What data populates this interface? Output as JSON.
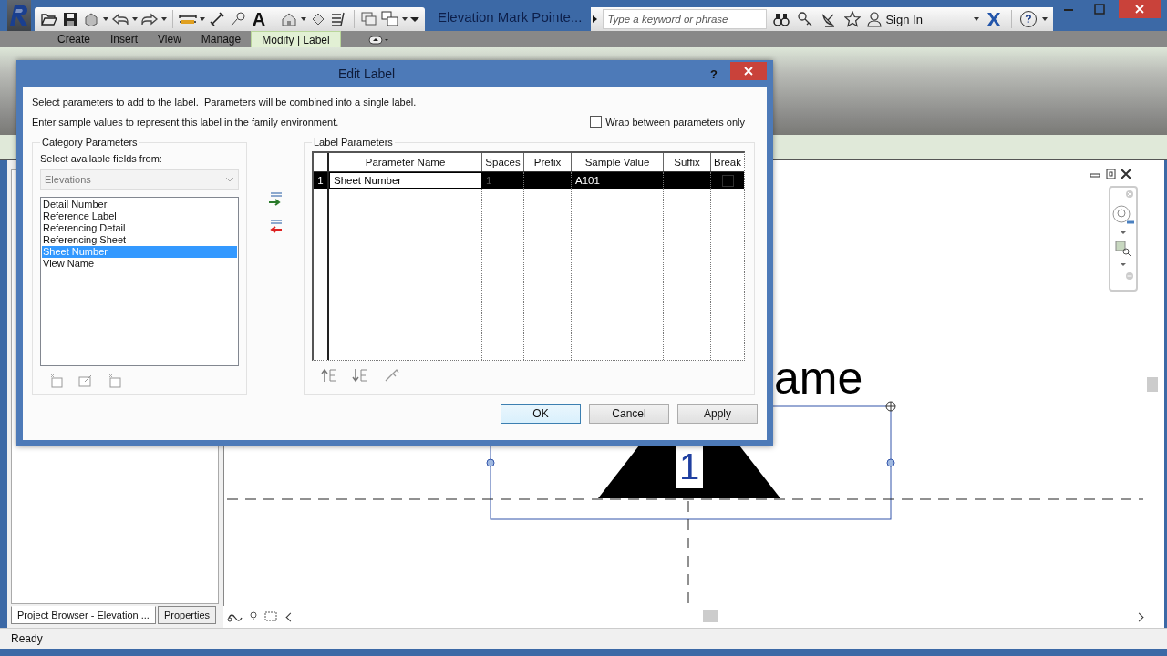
{
  "app": {
    "title": "Elevation Mark Pointe...",
    "text_tool_glyph": "A",
    "search": {
      "placeholder": "Type a keyword or phrase"
    },
    "sign_in": "Sign In",
    "help": "?"
  },
  "ribbon_tabs": [
    {
      "label": "Create",
      "selected": false
    },
    {
      "label": "Insert",
      "selected": false
    },
    {
      "label": "View",
      "selected": false
    },
    {
      "label": "Manage",
      "selected": false
    },
    {
      "label": "Modify | Label",
      "selected": true
    }
  ],
  "canvas": {
    "label_text": "ame",
    "mark_number": "1"
  },
  "bottom_tabs": [
    {
      "label": "Project Browser - Elevation ...",
      "selected": true
    },
    {
      "label": "Properties",
      "selected": false
    }
  ],
  "status_bar": "Ready",
  "dialog": {
    "title": "Edit Label",
    "help": "?",
    "intro_lines": [
      "Select parameters to add to the label.  Parameters will be combined into a single label.",
      "Enter sample values to represent this label in the family environment."
    ],
    "wrap_option": {
      "label": "Wrap between parameters only",
      "checked": false
    },
    "category": {
      "title": "Category Parameters",
      "prompt": "Select available fields from:",
      "dropdown": {
        "value": "Elevations",
        "disabled": true
      },
      "fields": [
        {
          "label": "Detail Number",
          "selected": false
        },
        {
          "label": "Reference Label",
          "selected": false
        },
        {
          "label": "Referencing Detail",
          "selected": false
        },
        {
          "label": "Referencing Sheet",
          "selected": false
        },
        {
          "label": "Sheet Number",
          "selected": true
        },
        {
          "label": "View Name",
          "selected": false
        }
      ]
    },
    "label_parameters": {
      "title": "Label Parameters",
      "columns": [
        "Parameter Name",
        "Spaces",
        "Prefix",
        "Sample Value",
        "Suffix",
        "Break"
      ],
      "rows": [
        {
          "index": "1",
          "parameter_name": "Sheet Number",
          "spaces": "1",
          "sample_value": "A101",
          "break": false,
          "selected": true
        }
      ]
    },
    "buttons": [
      "OK",
      "Cancel",
      "Apply"
    ]
  }
}
